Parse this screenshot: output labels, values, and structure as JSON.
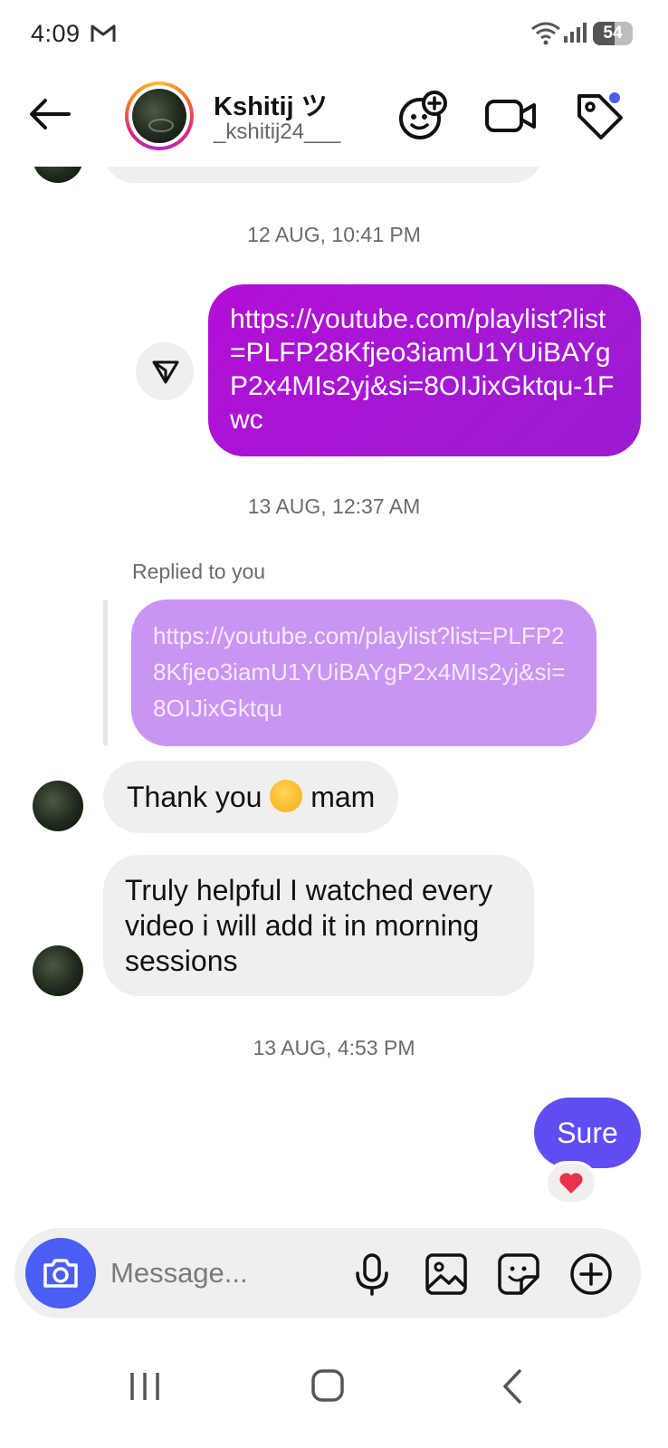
{
  "status": {
    "time": "4:09",
    "battery": "54",
    "battery_level": 0.54
  },
  "header": {
    "name": "Kshitij ツ",
    "username": "_kshitij24___"
  },
  "messages": {
    "ts1": "12 AUG, 10:41 PM",
    "link_text": "https://youtube.com/playlist?list=PLFP28Kfjeo3iamU1YUiBAYgP2x4MIs2yj&si=8OIJixGktqu-1Fwc",
    "ts2": "13 AUG, 12:37 AM",
    "replied_label": "Replied to you",
    "reply_quote": "https://youtube.com/playlist?list=PLFP28Kfjeo3iamU1YUiBAYgP2x4MIs2yj&si=8OIJixGktqu",
    "thanks_before": "Thank you ",
    "thanks_after": " mam",
    "truly": "Truly helpful I watched every video i will add it in morning sessions",
    "ts3": "13 AUG, 4:53 PM",
    "sure": "Sure",
    "reaction": "heart"
  },
  "composer": {
    "placeholder": "Message..."
  },
  "colors": {
    "link_bubble": "#a418d3",
    "reply_bubble": "#c994f2",
    "sure_bubble": "#5e4ef2",
    "accent": "#4a5ef5",
    "incoming_bubble": "#efefef"
  }
}
